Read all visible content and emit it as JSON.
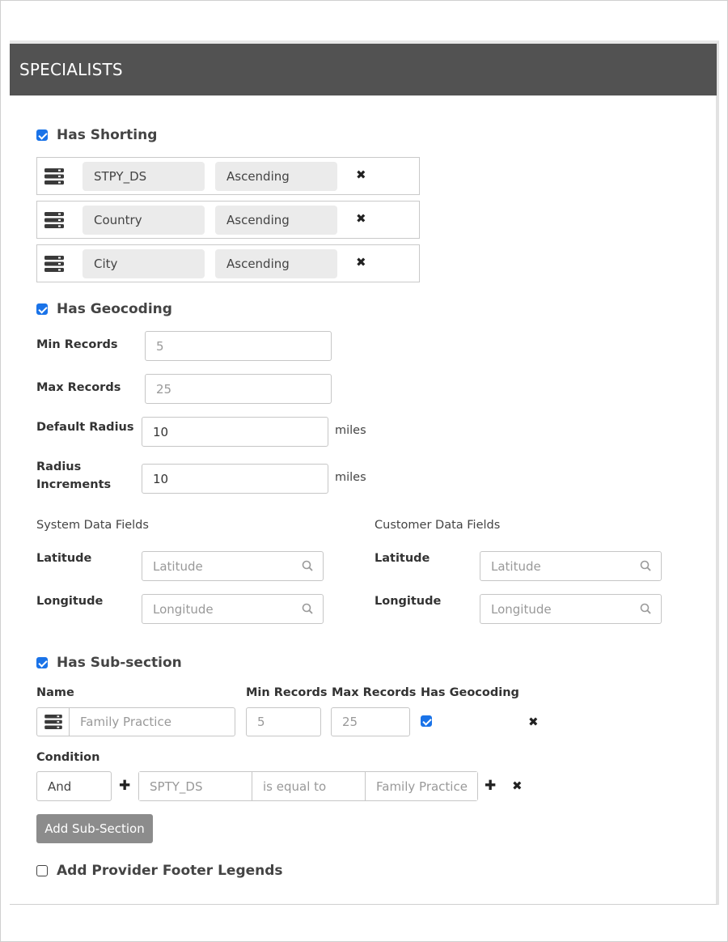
{
  "header": {
    "title": "SPECIALISTS"
  },
  "sorting": {
    "title": "Has Shorting",
    "checked": true,
    "rows": [
      {
        "field": "STPY_DS",
        "order": "Ascending"
      },
      {
        "field": "Country",
        "order": "Ascending"
      },
      {
        "field": "City",
        "order": "Ascending"
      }
    ]
  },
  "geocoding": {
    "title": "Has Geocoding",
    "checked": true,
    "min_records_label": "Min Records",
    "min_records_placeholder": "5",
    "max_records_label": "Max Records",
    "max_records_placeholder": "25",
    "default_radius_label": "Default Radius",
    "default_radius_value": "10",
    "radius_increments_label_line1": "Radius",
    "radius_increments_label_line2": "Increments",
    "radius_increments_value": "10",
    "unit": "miles",
    "system_fields_title": "System Data Fields",
    "customer_fields_title": "Customer Data Fields",
    "latitude_label": "Latitude",
    "longitude_label": "Longitude",
    "latitude_placeholder": "Latitude",
    "longitude_placeholder": "Longitude"
  },
  "subsection": {
    "title": "Has Sub-section",
    "checked": true,
    "col_name": "Name",
    "col_min": "Min Records",
    "col_max": "Max Records",
    "col_geo": "Has Geocoding",
    "name_placeholder": "Family Practice",
    "min_placeholder": "5",
    "max_placeholder": "25",
    "geo_checked": true,
    "condition_label": "Condition",
    "condition_operator": "And",
    "condition_field_placeholder": "SPTY_DS",
    "condition_op_placeholder": "is equal to",
    "condition_value_placeholder": "Family Practice",
    "add_button": "Add Sub-Section"
  },
  "footer_legends": {
    "title": "Add Provider Footer Legends",
    "checked": false
  },
  "colors": {
    "header_bg": "#525252",
    "checkbox": "#1a73e8",
    "button": "#8c8c8c"
  }
}
